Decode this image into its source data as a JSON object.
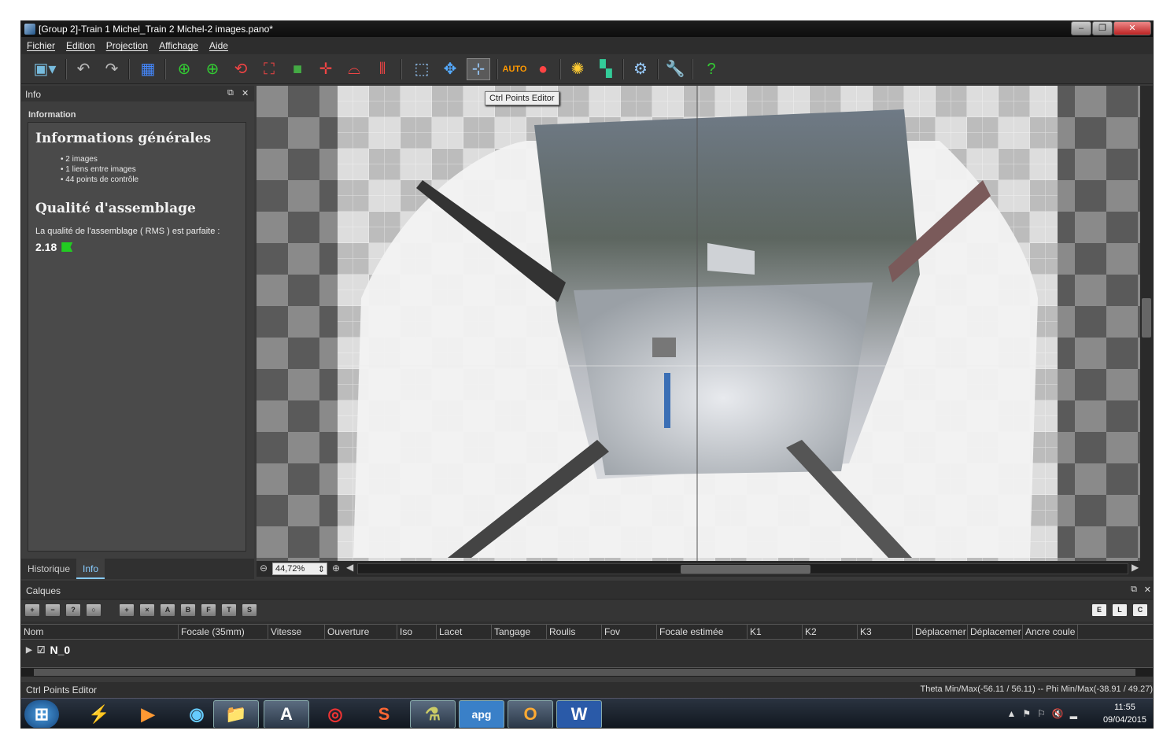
{
  "window": {
    "title": "[Group 2]-Train 1 Michel_Train 2 Michel-2 images.pano*"
  },
  "menu": [
    "Fichier",
    "Edition",
    "Projection",
    "Affichage",
    "Aide"
  ],
  "toolbar": {
    "tooltip": "Ctrl Points Editor",
    "icons": [
      "save-menu-icon",
      "undo-icon",
      "redo-icon",
      "grid-icon",
      "crosshair-icon",
      "crosshair-plus-icon",
      "rotate-icon",
      "crop-red-icon",
      "square-icon",
      "center-icon",
      "horizon-icon",
      "vertical-lines-icon",
      "select-icon",
      "move-icon",
      "ctrl-points-icon",
      "auto-color-icon",
      "color-wheel-icon",
      "exposure-icon",
      "blend-icon",
      "settings-gear-icon",
      "wrench-icon",
      "help-icon"
    ]
  },
  "info_panel": {
    "header": "Info",
    "section": "Information",
    "general_title": "Informations générales",
    "bullets": [
      "2 images",
      "1 liens entre images",
      "44 points de contrôle"
    ],
    "quality_title": "Qualité d'assemblage",
    "quality_text": "La qualité de l'assemblage ( RMS ) est parfaite :",
    "rms_value": "2.18",
    "tabs": [
      "Historique",
      "Info"
    ]
  },
  "viewport": {
    "zoom": "44,72%"
  },
  "calques": {
    "header": "Calques",
    "columns": [
      "Nom",
      "Focale (35mm)",
      "Vitesse",
      "Ouverture",
      "Iso",
      "Lacet",
      "Tangage",
      "Roulis",
      "Fov",
      "Focale estimée",
      "K1",
      "K2",
      "K3",
      "Déplacemer",
      "Déplacemer",
      "Ancre coule"
    ],
    "rows": [
      {
        "name": "N_0"
      }
    ],
    "icon_letters": [
      "A",
      "B",
      "F",
      "T",
      "S"
    ],
    "right_icons": [
      "E",
      "L",
      "C"
    ]
  },
  "status": {
    "left": "Ctrl Points Editor",
    "right": "Theta Min/Max(-56.11 / 56.11)   --   Phi Min/Max(-38.91 / 49.27)"
  },
  "taskbar": {
    "time": "11:55",
    "date": "09/04/2015",
    "apps": [
      "start-icon",
      "sketch-icon",
      "media-icon",
      "wifi-icon",
      "explorer-icon",
      "app-a-icon",
      "chrome-icon",
      "office-s-icon",
      "flask-icon",
      "apg-icon",
      "outlook-icon",
      "word-icon"
    ],
    "apg_label": "apg"
  }
}
